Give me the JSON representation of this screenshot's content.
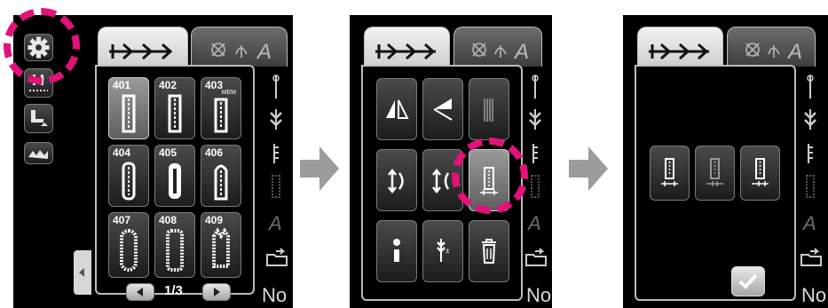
{
  "screen1": {
    "patterns": [
      {
        "num": "401",
        "mem": ""
      },
      {
        "num": "402",
        "mem": ""
      },
      {
        "num": "403",
        "mem": "MEM"
      },
      {
        "num": "404",
        "mem": ""
      },
      {
        "num": "405",
        "mem": ""
      },
      {
        "num": "406",
        "mem": ""
      },
      {
        "num": "407",
        "mem": ""
      },
      {
        "num": "408",
        "mem": ""
      },
      {
        "num": "409",
        "mem": ""
      }
    ],
    "page_indicator": "1/3",
    "no_label": "No"
  },
  "screen2": {
    "no_label": "No"
  },
  "screen3": {
    "no_label": "No"
  },
  "colors": {
    "highlight": "#e2127a",
    "arrow": "#9c9c9c",
    "panel_bg": "#000000"
  },
  "icons": {
    "tab_active": "utility-stitch-tab-icon",
    "tab_inactive": "decorative-character-tab-icon",
    "settings": "gear-icon",
    "ok": "checkmark-icon"
  }
}
